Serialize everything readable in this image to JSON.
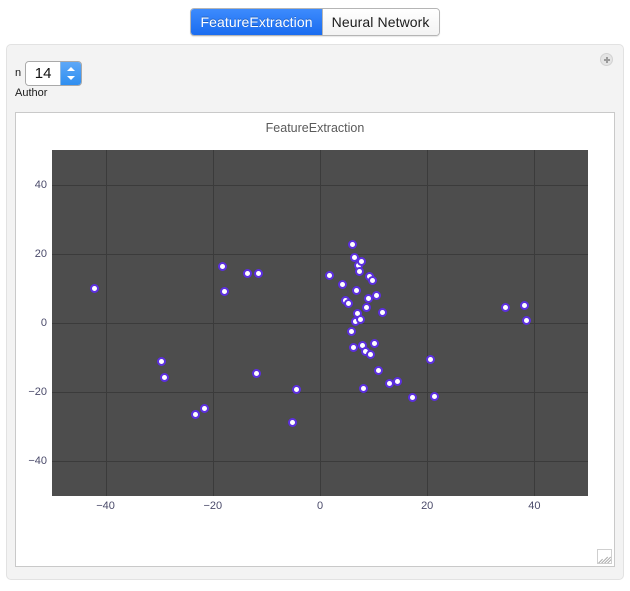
{
  "tabs": [
    {
      "label": "FeatureExtraction",
      "active": true
    },
    {
      "label": "Neural Network",
      "active": false
    }
  ],
  "panel": {
    "add_icon": "plus-circle-icon"
  },
  "controls": {
    "n_label": "n",
    "n_value": "14",
    "author_label": "Author",
    "increment_icon": "chevron-up-icon",
    "decrement_icon": "chevron-down-icon"
  },
  "colors": {
    "accent": "#1a6cf0",
    "plot_background": "#4d4d4d",
    "grid": "#3b3b3b",
    "point": "#5c2fe0",
    "point_highlight": "#ffffff",
    "tick_text": "#4a4a6a",
    "title_text": "#5a5a5a"
  },
  "chart_data": {
    "type": "scatter",
    "title": "FeatureExtraction",
    "xlabel": "",
    "ylabel": "",
    "xlim": [
      -50,
      50
    ],
    "ylim": [
      -50,
      50
    ],
    "xticks": [
      -40,
      -20,
      0,
      20,
      40
    ],
    "yticks": [
      -40,
      -20,
      0,
      20,
      40
    ],
    "grid": true,
    "legend": null,
    "series": [
      {
        "name": "FeatureExtraction",
        "marker": "circle",
        "color": "#5c2fe0",
        "points": [
          [
            -42.0,
            10.0
          ],
          [
            -29.5,
            -11.2
          ],
          [
            -29.0,
            -15.8
          ],
          [
            -23.2,
            -26.5
          ],
          [
            -21.6,
            -24.8
          ],
          [
            -18.2,
            16.2
          ],
          [
            -17.8,
            9.2
          ],
          [
            -13.6,
            14.3
          ],
          [
            -11.8,
            -14.5
          ],
          [
            -11.4,
            14.2
          ],
          [
            -5.2,
            -28.8
          ],
          [
            -4.4,
            -19.2
          ],
          [
            1.8,
            13.6
          ],
          [
            4.2,
            11.0
          ],
          [
            4.8,
            6.4
          ],
          [
            5.4,
            5.6
          ],
          [
            5.8,
            -2.4
          ],
          [
            6.0,
            22.6
          ],
          [
            6.2,
            -7.2
          ],
          [
            6.4,
            19.0
          ],
          [
            6.6,
            0.4
          ],
          [
            6.8,
            9.4
          ],
          [
            7.0,
            2.8
          ],
          [
            7.2,
            16.6
          ],
          [
            7.4,
            14.8
          ],
          [
            7.6,
            1.0
          ],
          [
            7.8,
            17.8
          ],
          [
            8.0,
            -6.4
          ],
          [
            8.2,
            -19.0
          ],
          [
            8.4,
            -8.2
          ],
          [
            8.6,
            4.6
          ],
          [
            9.0,
            7.2
          ],
          [
            9.2,
            13.4
          ],
          [
            9.4,
            -9.2
          ],
          [
            9.8,
            12.2
          ],
          [
            10.2,
            -5.8
          ],
          [
            10.6,
            8.0
          ],
          [
            11.0,
            -13.6
          ],
          [
            11.6,
            3.0
          ],
          [
            13.0,
            -17.6
          ],
          [
            14.4,
            -16.8
          ],
          [
            17.2,
            -21.4
          ],
          [
            20.6,
            -10.6
          ],
          [
            21.4,
            -21.2
          ],
          [
            34.6,
            4.6
          ],
          [
            38.2,
            5.0
          ],
          [
            38.6,
            0.6
          ]
        ]
      }
    ]
  }
}
